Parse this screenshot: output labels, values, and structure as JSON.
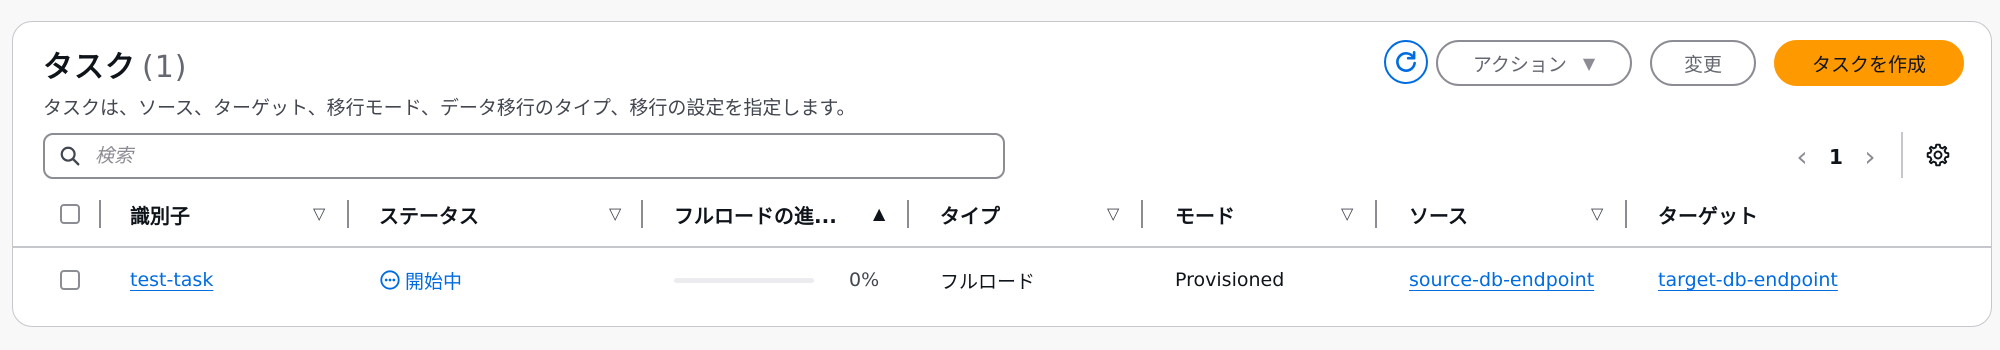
{
  "panel": {
    "title": "タスク",
    "count": "(1)",
    "description": "タスクは、ソース、ターゲット、移行モード、データ移行のタイプ、移行の設定を指定します。"
  },
  "toolbar": {
    "refresh_icon": "refresh-icon",
    "action_label": "アクション",
    "edit_label": "変更",
    "create_label": "タスクを作成"
  },
  "search": {
    "placeholder": "検索",
    "value": ""
  },
  "pagination": {
    "current_page": "1"
  },
  "table": {
    "columns": [
      {
        "label": "識別子",
        "sort": "none"
      },
      {
        "label": "ステータス",
        "sort": "none"
      },
      {
        "label": "フルロードの進...",
        "sort": "ascending"
      },
      {
        "label": "タイプ",
        "sort": "none"
      },
      {
        "label": "モード",
        "sort": "none"
      },
      {
        "label": "ソース",
        "sort": "none"
      },
      {
        "label": "ターゲット",
        "sort": "none"
      }
    ],
    "rows": [
      {
        "identifier": "test-task",
        "status": "開始中",
        "full_load_progress": 0,
        "full_load_progress_text": "0%",
        "type": "フルロード",
        "mode": "Provisioned",
        "source": "source-db-endpoint",
        "target": "target-db-endpoint"
      }
    ]
  },
  "colors": {
    "link": "#006ce0",
    "primary_button": "#ff9900",
    "border": "#c6c6cd"
  }
}
